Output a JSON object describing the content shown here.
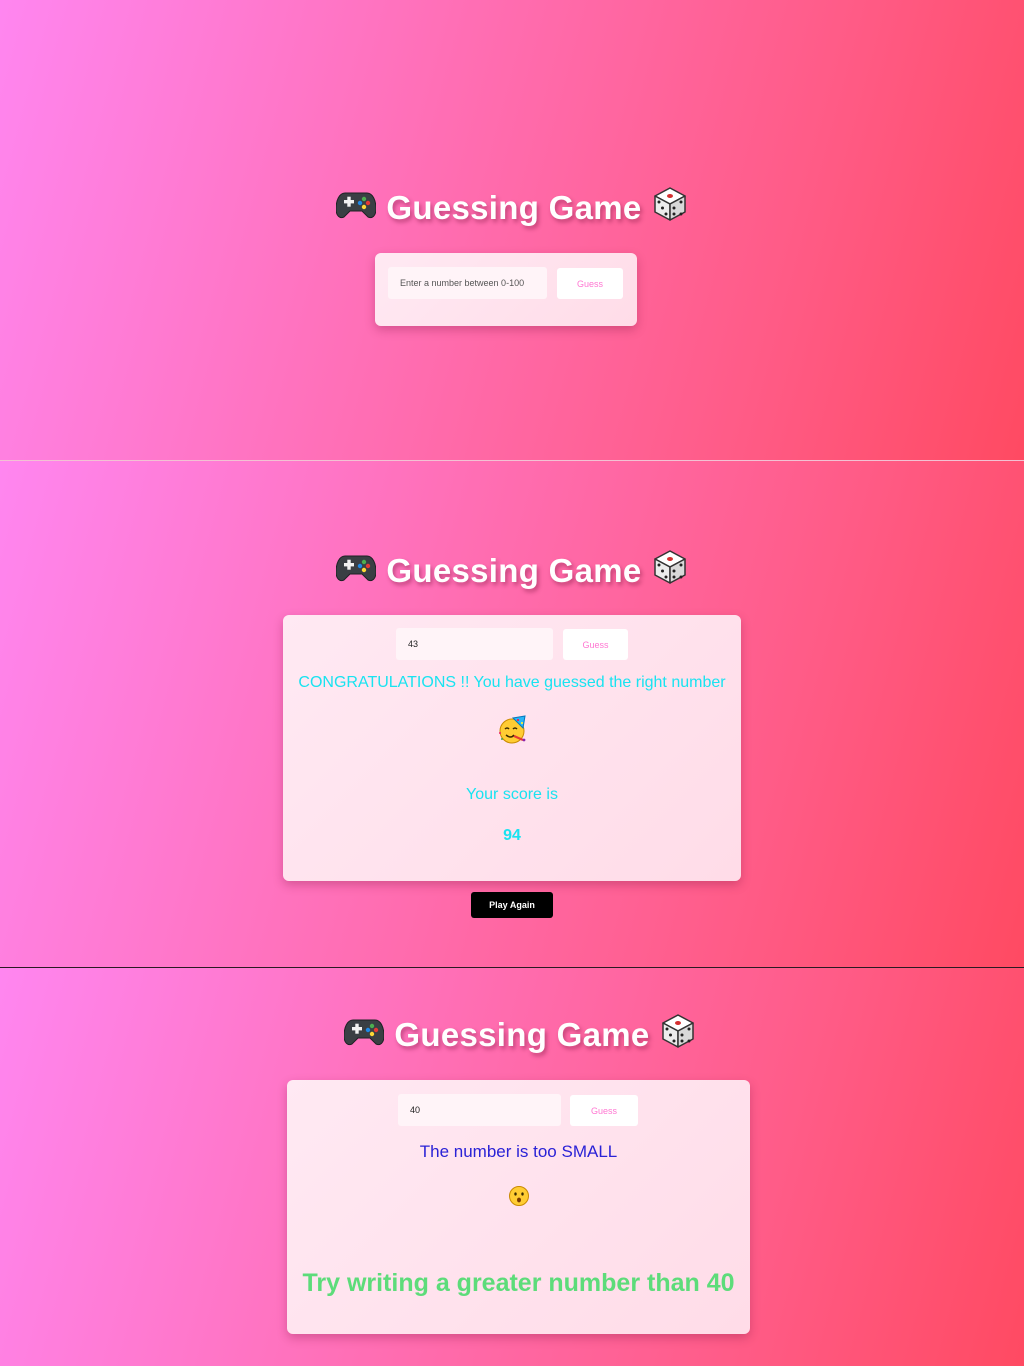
{
  "title": {
    "text": "Guessing Game",
    "left_icon": "game-controller-icon",
    "right_icon": "dice-icon"
  },
  "screens": [
    {
      "input": {
        "value": "",
        "placeholder": "Enter a number between 0-100"
      },
      "guess_label": "Guess"
    },
    {
      "input": {
        "value": "43",
        "placeholder": "Enter a number between 0-100"
      },
      "guess_label": "Guess",
      "result_message": "CONGRATULATIONS !! You have guessed the right number",
      "result_icon": "partying-face-icon",
      "score_label": "Your score is",
      "score_value": "94",
      "play_again_label": "Play Again"
    },
    {
      "input": {
        "value": "40",
        "placeholder": "Enter a number between 0-100"
      },
      "guess_label": "Guess",
      "result_message": "The number is too SMALL",
      "result_icon": "hushed-face-icon",
      "hint": "Try writing a greater number than 40"
    }
  ],
  "colors": {
    "success_text": "#19e3f0",
    "small_text": "#2a22d6",
    "hint_text": "#5ddc7a",
    "guess_button_text": "#ff77d2"
  }
}
